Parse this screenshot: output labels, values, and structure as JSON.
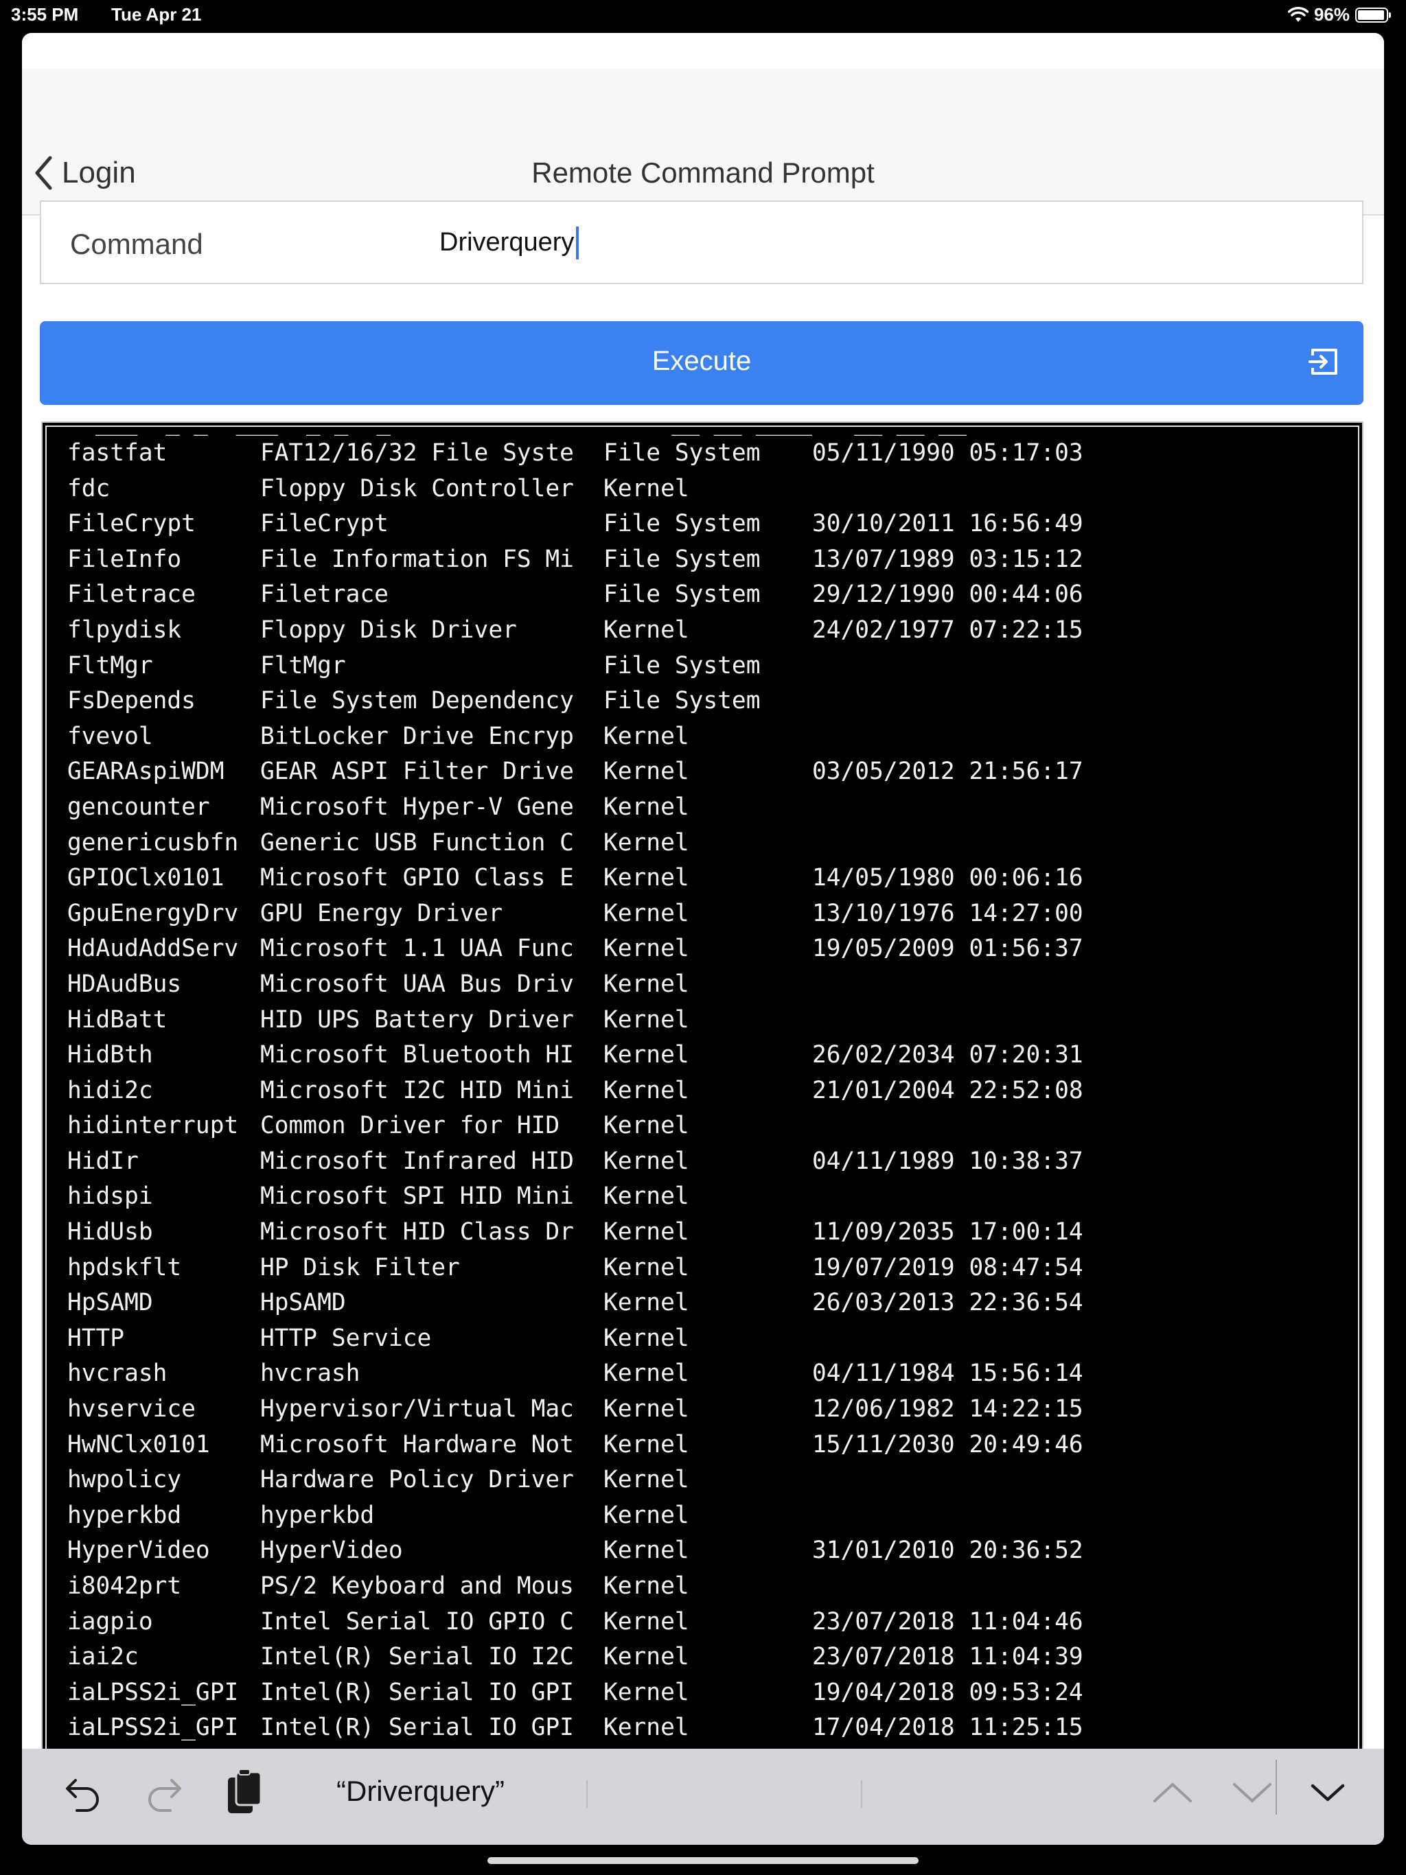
{
  "status_bar": {
    "time": "3:55 PM",
    "date": "Tue Apr 21",
    "battery_percent": "96%",
    "battery_level": 0.96
  },
  "nav": {
    "back_label": "Login",
    "title": "Remote Command Prompt"
  },
  "command": {
    "label": "Command",
    "value": "Driverquery"
  },
  "execute": {
    "label": "Execute"
  },
  "terminal": {
    "partial_top_line": "  ___  _ _  ___  _ _  _                    __ __ ____   __ __ __",
    "rows": [
      {
        "module": "fastfat",
        "display": "FAT12/16/32 File Syste",
        "type": "File System",
        "date": "05/11/1990 05:17:03"
      },
      {
        "module": "fdc",
        "display": "Floppy Disk Controller",
        "type": "Kernel",
        "date": ""
      },
      {
        "module": "FileCrypt",
        "display": "FileCrypt",
        "type": "File System",
        "date": "30/10/2011 16:56:49"
      },
      {
        "module": "FileInfo",
        "display": "File Information FS Mi",
        "type": "File System",
        "date": "13/07/1989 03:15:12"
      },
      {
        "module": "Filetrace",
        "display": "Filetrace",
        "type": "File System",
        "date": "29/12/1990 00:44:06"
      },
      {
        "module": "flpydisk",
        "display": "Floppy Disk Driver",
        "type": "Kernel",
        "date": "24/02/1977 07:22:15"
      },
      {
        "module": "FltMgr",
        "display": "FltMgr",
        "type": "File System",
        "date": ""
      },
      {
        "module": "FsDepends",
        "display": "File System Dependency",
        "type": "File System",
        "date": ""
      },
      {
        "module": "fvevol",
        "display": "BitLocker Drive Encryp",
        "type": "Kernel",
        "date": ""
      },
      {
        "module": "GEARAspiWDM",
        "display": "GEAR ASPI Filter Drive",
        "type": "Kernel",
        "date": "03/05/2012 21:56:17"
      },
      {
        "module": "gencounter",
        "display": "Microsoft Hyper-V Gene",
        "type": "Kernel",
        "date": ""
      },
      {
        "module": "genericusbfn",
        "display": "Generic USB Function C",
        "type": "Kernel",
        "date": ""
      },
      {
        "module": "GPIOClx0101",
        "display": "Microsoft GPIO Class E",
        "type": "Kernel",
        "date": "14/05/1980 00:06:16"
      },
      {
        "module": "GpuEnergyDrv",
        "display": "GPU Energy Driver",
        "type": "Kernel",
        "date": "13/10/1976 14:27:00"
      },
      {
        "module": "HdAudAddServ",
        "display": "Microsoft 1.1 UAA Func",
        "type": "Kernel",
        "date": "19/05/2009 01:56:37"
      },
      {
        "module": "HDAudBus",
        "display": "Microsoft UAA Bus Driv",
        "type": "Kernel",
        "date": ""
      },
      {
        "module": "HidBatt",
        "display": "HID UPS Battery Driver",
        "type": "Kernel",
        "date": ""
      },
      {
        "module": "HidBth",
        "display": "Microsoft Bluetooth HI",
        "type": "Kernel",
        "date": "26/02/2034 07:20:31"
      },
      {
        "module": "hidi2c",
        "display": "Microsoft I2C HID Mini",
        "type": "Kernel",
        "date": "21/01/2004 22:52:08"
      },
      {
        "module": "hidinterrupt",
        "display": "Common Driver for HID",
        "type": "Kernel",
        "date": ""
      },
      {
        "module": "HidIr",
        "display": "Microsoft Infrared HID",
        "type": "Kernel",
        "date": "04/11/1989 10:38:37"
      },
      {
        "module": "hidspi",
        "display": "Microsoft SPI HID Mini",
        "type": "Kernel",
        "date": ""
      },
      {
        "module": "HidUsb",
        "display": "Microsoft HID Class Dr",
        "type": "Kernel",
        "date": "11/09/2035 17:00:14"
      },
      {
        "module": "hpdskflt",
        "display": "HP Disk Filter",
        "type": "Kernel",
        "date": "19/07/2019 08:47:54"
      },
      {
        "module": "HpSAMD",
        "display": "HpSAMD",
        "type": "Kernel",
        "date": "26/03/2013 22:36:54"
      },
      {
        "module": "HTTP",
        "display": "HTTP Service",
        "type": "Kernel",
        "date": ""
      },
      {
        "module": "hvcrash",
        "display": "hvcrash",
        "type": "Kernel",
        "date": "04/11/1984 15:56:14"
      },
      {
        "module": "hvservice",
        "display": "Hypervisor/Virtual Mac",
        "type": "Kernel",
        "date": "12/06/1982 14:22:15"
      },
      {
        "module": "HwNClx0101",
        "display": "Microsoft Hardware Not",
        "type": "Kernel",
        "date": "15/11/2030 20:49:46"
      },
      {
        "module": "hwpolicy",
        "display": "Hardware Policy Driver",
        "type": "Kernel",
        "date": ""
      },
      {
        "module": "hyperkbd",
        "display": "hyperkbd",
        "type": "Kernel",
        "date": ""
      },
      {
        "module": "HyperVideo",
        "display": "HyperVideo",
        "type": "Kernel",
        "date": "31/01/2010 20:36:52"
      },
      {
        "module": "i8042prt",
        "display": "PS/2 Keyboard and Mous",
        "type": "Kernel",
        "date": ""
      },
      {
        "module": "iagpio",
        "display": "Intel Serial IO GPIO C",
        "type": "Kernel",
        "date": "23/07/2018 11:04:46"
      },
      {
        "module": "iai2c",
        "display": "Intel(R) Serial IO I2C",
        "type": "Kernel",
        "date": "23/07/2018 11:04:39"
      },
      {
        "module": "iaLPSS2i_GPI",
        "display": "Intel(R) Serial IO GPI",
        "type": "Kernel",
        "date": "19/04/2018 09:53:24"
      },
      {
        "module": "iaLPSS2i_GPI",
        "display": "Intel(R) Serial IO GPI",
        "type": "Kernel",
        "date": "17/04/2018 11:25:15"
      }
    ]
  },
  "keyboard_bar": {
    "suggestion": "“Driverquery”",
    "icons": [
      "undo-icon",
      "redo-icon",
      "paste-icon",
      "chevron-up-icon",
      "chevron-down-icon",
      "dismiss-keyboard-icon"
    ]
  }
}
